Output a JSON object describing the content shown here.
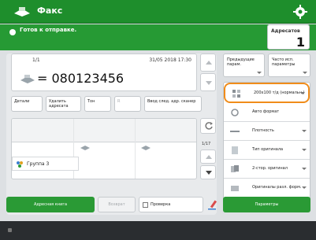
{
  "title": "Факс",
  "status": "Готов к отправке.",
  "copies": {
    "label": "Адресатов",
    "value": "1"
  },
  "destination": {
    "counter": "1/1",
    "datetime": "31/05 2018 17:30",
    "number": "= 080123456"
  },
  "row_buttons": [
    {
      "label": "Детали"
    },
    {
      "label": "Удалить адресата"
    },
    {
      "label": "Тон"
    },
    {
      "label": "R"
    },
    {
      "label": "Ввод след. адр. сканер"
    }
  ],
  "list": {
    "page": "1/17",
    "group_label": "Группа 3"
  },
  "bottom_buttons": {
    "address_book": "Адресная книга",
    "recent": "Возврат",
    "check_label": "Проверка",
    "settings": "Параметры"
  },
  "right": {
    "top_left": "Предыдущие парам.",
    "top_right": "Часто исп. параметры",
    "items": [
      {
        "label": "200x100 т/д (нормальн.)",
        "highlight": true
      },
      {
        "label": "Авто формат"
      },
      {
        "label": "Плотность"
      },
      {
        "label": "Тип оригинала"
      },
      {
        "label": "2-стор. оригинал"
      },
      {
        "label": "Оригиналы разл. форм."
      }
    ]
  },
  "colors": {
    "accent_green": "#1e8e2c",
    "highlight_orange": "#f08c1a"
  }
}
